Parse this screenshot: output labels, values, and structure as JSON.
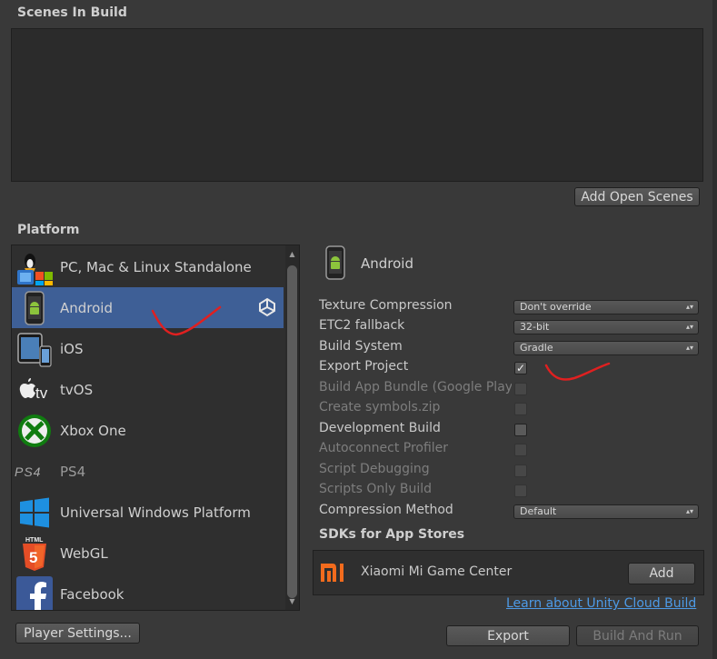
{
  "scenes": {
    "title": "Scenes In Build",
    "add_open_scenes": "Add Open Scenes"
  },
  "platform": {
    "title": "Platform",
    "items": [
      {
        "label": "PC, Mac & Linux Standalone",
        "icon": "pc-standalone-icon"
      },
      {
        "label": "Android",
        "icon": "android-phone-icon",
        "selected": true
      },
      {
        "label": "iOS",
        "icon": "ios-devices-icon"
      },
      {
        "label": "tvOS",
        "icon": "apple-tv-icon"
      },
      {
        "label": "Xbox One",
        "icon": "xbox-icon"
      },
      {
        "label": "PS4",
        "icon": "ps4-logo-icon"
      },
      {
        "label": "Universal Windows Platform",
        "icon": "windows-icon"
      },
      {
        "label": "WebGL",
        "icon": "html5-icon"
      },
      {
        "label": "Facebook",
        "icon": "facebook-icon"
      }
    ]
  },
  "settings": {
    "platform_name": "Android",
    "rows": [
      {
        "label": "Texture Compression",
        "type": "dropdown",
        "value": "Don't override"
      },
      {
        "label": "ETC2 fallback",
        "type": "dropdown",
        "value": "32-bit"
      },
      {
        "label": "Build System",
        "type": "dropdown",
        "value": "Gradle"
      },
      {
        "label": "Export Project",
        "type": "checkbox",
        "checked": true
      },
      {
        "label": "Build App Bundle (Google Play",
        "type": "checkbox",
        "checked": false,
        "disabled": true
      },
      {
        "label": "Create symbols.zip",
        "type": "checkbox",
        "checked": false,
        "disabled": true
      },
      {
        "label": "Development Build",
        "type": "checkbox",
        "checked": false
      },
      {
        "label": "Autoconnect Profiler",
        "type": "checkbox",
        "checked": false,
        "disabled": true
      },
      {
        "label": "Script Debugging",
        "type": "checkbox",
        "checked": false,
        "disabled": true
      },
      {
        "label": "Scripts Only Build",
        "type": "checkbox",
        "checked": false,
        "disabled": true
      },
      {
        "label": "Compression Method",
        "type": "dropdown",
        "value": "Default"
      }
    ],
    "sdks_title": "SDKs for App Stores",
    "sdk": {
      "name": "Xiaomi Mi Game Center",
      "logo_text": "mi",
      "add_label": "Add"
    },
    "cloud_link": "Learn about Unity Cloud Build"
  },
  "footer": {
    "player_settings": "Player Settings...",
    "export": "Export",
    "build_and_run": "Build And Run"
  },
  "colors": {
    "selection": "#3e5f96",
    "link": "#4d9ae6",
    "annotation": "#e02020",
    "mi_orange": "#f26b1d"
  }
}
